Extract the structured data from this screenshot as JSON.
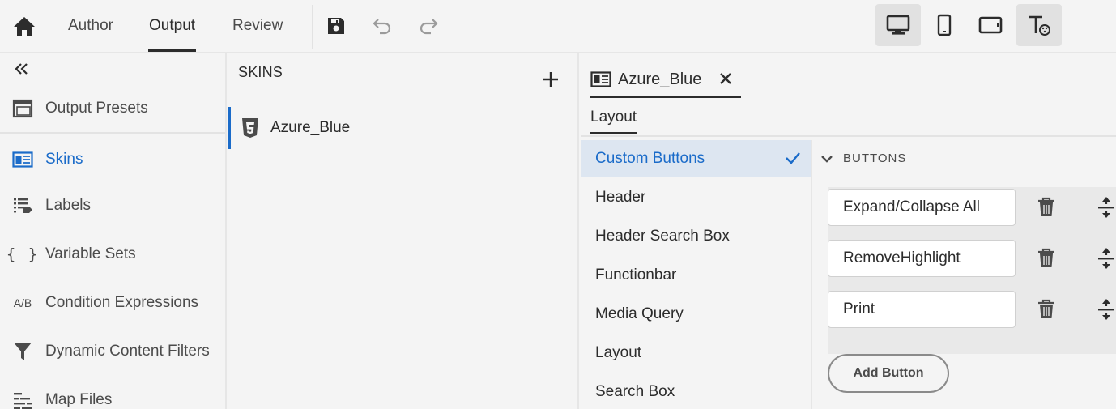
{
  "topbar": {
    "tabs": [
      {
        "label": "Author",
        "active": false
      },
      {
        "label": "Output",
        "active": true
      },
      {
        "label": "Review",
        "active": false
      }
    ],
    "icons": [
      "home-icon",
      "save-icon",
      "undo-icon",
      "redo-icon",
      "desktop-view-icon",
      "mobile-view-icon",
      "tablet-view-icon",
      "text-style-icon"
    ]
  },
  "sidebar": {
    "items": [
      {
        "label": "Output Presets",
        "icon": "output-presets-icon"
      },
      {
        "label": "Skins",
        "icon": "skins-icon",
        "active": true
      },
      {
        "label": "Labels",
        "icon": "labels-icon"
      },
      {
        "label": "Variable Sets",
        "icon": "variable-sets-icon"
      },
      {
        "label": "Condition Expressions",
        "icon": "condition-expressions-icon"
      },
      {
        "label": "Dynamic Content Filters",
        "icon": "filter-icon"
      },
      {
        "label": "Map Files",
        "icon": "map-files-icon"
      }
    ],
    "ab_glyph": "A/B",
    "braces_glyph": "{ }"
  },
  "skins": {
    "heading": "SKINS",
    "items": [
      {
        "label": "Azure_Blue",
        "icon": "html5-icon"
      }
    ]
  },
  "editor": {
    "doc_tab_label": "Azure_Blue",
    "layout_tab": "Layout",
    "sections": [
      {
        "label": "Custom Buttons",
        "active": true
      },
      {
        "label": "Header"
      },
      {
        "label": "Header Search Box"
      },
      {
        "label": "Functionbar"
      },
      {
        "label": "Media Query"
      },
      {
        "label": "Layout"
      },
      {
        "label": "Search Box"
      }
    ],
    "buttons_heading": "BUTTONS",
    "buttons": [
      {
        "value": "Expand/Collapse All"
      },
      {
        "value": "RemoveHighlight"
      },
      {
        "value": "Print"
      }
    ],
    "add_button_label": "Add Button"
  },
  "colors": {
    "accent": "#1a6bc9",
    "active_row_bg": "#dde6f1",
    "panel_bg": "#f4f4f4"
  }
}
